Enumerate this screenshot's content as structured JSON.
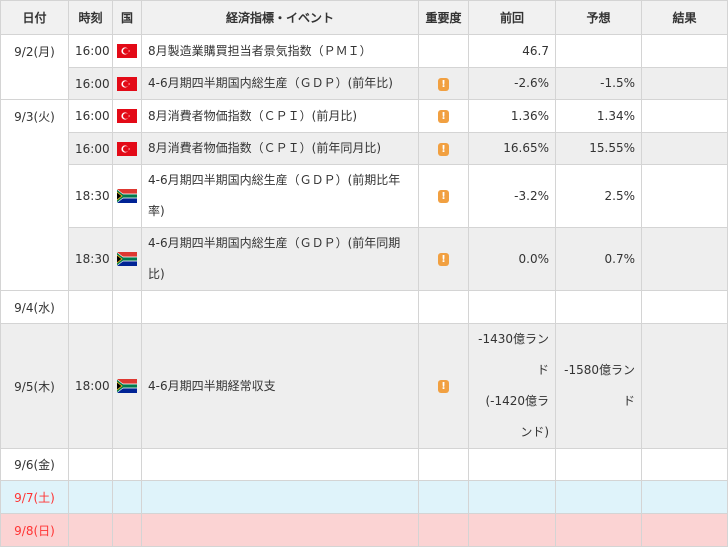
{
  "headers": {
    "date": "日付",
    "time": "時刻",
    "country": "国",
    "event": "経済指標・イベント",
    "importance": "重要度",
    "previous": "前回",
    "forecast": "予想",
    "result": "結果"
  },
  "dates": {
    "d1": "9/2(月)",
    "d2": "9/3(火)",
    "d3": "9/4(水)",
    "d4": "9/5(木)",
    "d5": "9/6(金)",
    "d6": "9/7(土)",
    "d7": "9/8(日)"
  },
  "rows": [
    {
      "time": "16:00",
      "country": "Turkey",
      "flag_icon": "turkey-flag-icon",
      "event": "8月製造業購買担当者景気指数（ＰＭＩ）",
      "importance": "",
      "previous": "46.7",
      "forecast": ""
    },
    {
      "time": "16:00",
      "country": "Turkey",
      "flag_icon": "turkey-flag-icon",
      "event": "4-6月期四半期国内総生産（ＧＤＰ）(前年比)",
      "importance": "!",
      "previous": "-2.6%",
      "forecast": "-1.5%"
    },
    {
      "time": "16:00",
      "country": "Turkey",
      "flag_icon": "turkey-flag-icon",
      "event": "8月消費者物価指数（ＣＰＩ）(前月比)",
      "importance": "!",
      "previous": "1.36%",
      "forecast": "1.34%"
    },
    {
      "time": "16:00",
      "country": "Turkey",
      "flag_icon": "turkey-flag-icon",
      "event": "8月消費者物価指数（ＣＰＩ）(前年同月比)",
      "importance": "!",
      "previous": "16.65%",
      "forecast": "15.55%"
    },
    {
      "time": "18:30",
      "country": "South Africa",
      "flag_icon": "south-africa-flag-icon",
      "event": "4-6月期四半期国内総生産（ＧＤＰ）(前期比年率)",
      "importance": "!",
      "previous": "-3.2%",
      "forecast": "2.5%"
    },
    {
      "time": "18:30",
      "country": "South Africa",
      "flag_icon": "south-africa-flag-icon",
      "event": "4-6月期四半期国内総生産（ＧＤＰ）(前年同期比)",
      "importance": "!",
      "previous": "0.0%",
      "forecast": "0.7%"
    },
    {
      "time": "18:00",
      "country": "South Africa",
      "flag_icon": "south-africa-flag-icon",
      "event": "4-6月期四半期経常収支",
      "importance": "!",
      "previous": "-1430億ランド\n(-1420億ランド)",
      "forecast": "-1580億ランド"
    }
  ],
  "colors": {
    "header_bg": "#f1f1f1",
    "row_gray": "#eeeeee",
    "saturday_bg": "#dff3fa",
    "sunday_bg": "#fbd3d3",
    "weekend_date": "#ff3333",
    "importance_icon": "#f1a041",
    "turkey_red": "#e30a17",
    "sa_green": "#007a4d"
  }
}
